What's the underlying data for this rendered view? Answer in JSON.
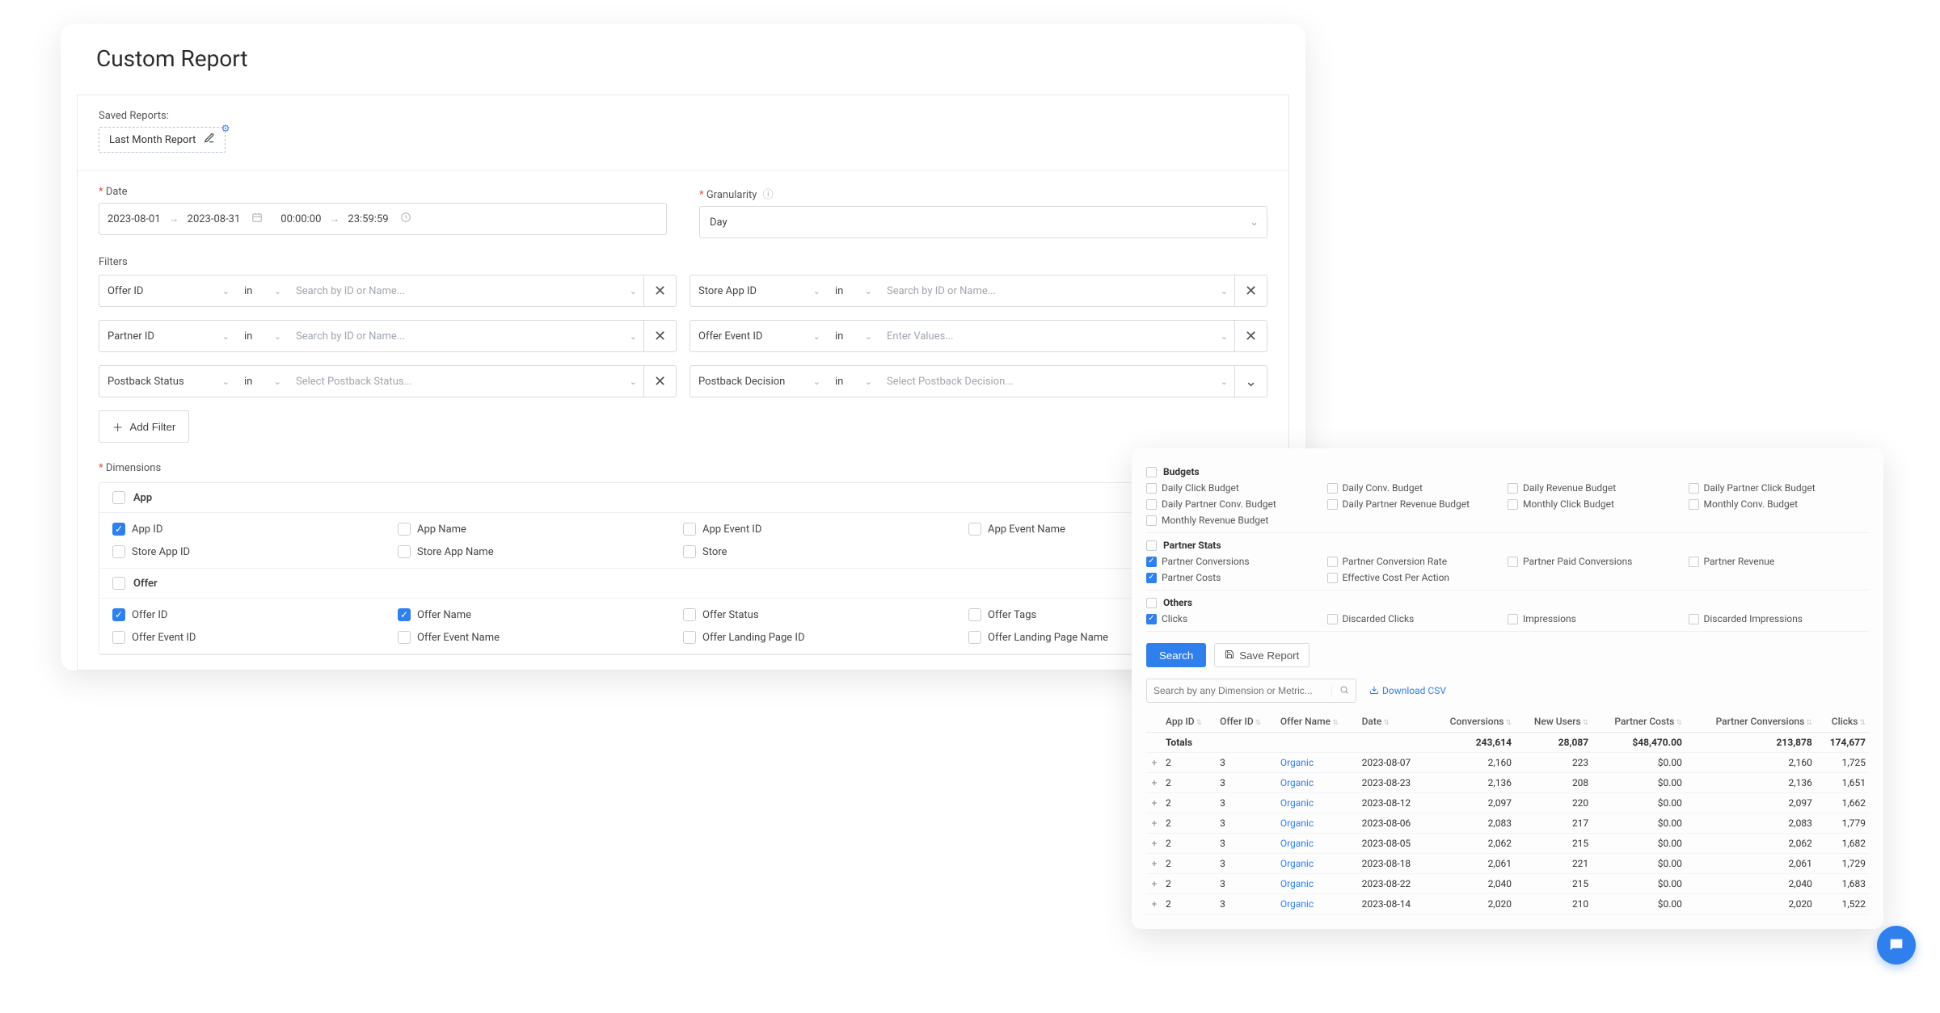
{
  "page": {
    "title": "Custom Report"
  },
  "saved": {
    "label": "Saved Reports:",
    "chip": "Last Month Report"
  },
  "date": {
    "label": "Date",
    "from": "2023-08-01",
    "to": "2023-08-31",
    "time_from": "00:00:00",
    "time_to": "23:59:59"
  },
  "granularity": {
    "label": "Granularity",
    "value": "Day"
  },
  "filters": {
    "title": "Filters",
    "rows": [
      {
        "left": {
          "field": "Offer ID",
          "op": "in",
          "placeholder": "Search by ID or Name..."
        },
        "right": {
          "field": "Store App ID",
          "op": "in",
          "placeholder": "Search by ID or Name..."
        }
      },
      {
        "left": {
          "field": "Partner ID",
          "op": "in",
          "placeholder": "Search by ID or Name..."
        },
        "right": {
          "field": "Offer Event ID",
          "op": "in",
          "placeholder": "Enter Values..."
        }
      },
      {
        "left": {
          "field": "Postback Status",
          "op": "in",
          "placeholder": "Select Postback Status..."
        },
        "right": {
          "field": "Postback Decision",
          "op": "in",
          "placeholder": "Select Postback Decision..."
        }
      }
    ],
    "add_button": "Add Filter"
  },
  "dimensions": {
    "label": "Dimensions",
    "groups": [
      {
        "title": "App",
        "checked": false,
        "items": [
          {
            "label": "App ID",
            "checked": true
          },
          {
            "label": "App Name",
            "checked": false
          },
          {
            "label": "App Event ID",
            "checked": false
          },
          {
            "label": "App Event Name",
            "checked": false
          },
          {
            "label": "Store App ID",
            "checked": false
          },
          {
            "label": "Store App Name",
            "checked": false
          },
          {
            "label": "Store",
            "checked": false
          }
        ]
      },
      {
        "title": "Offer",
        "checked": false,
        "items": [
          {
            "label": "Offer ID",
            "checked": true
          },
          {
            "label": "Offer Name",
            "checked": true
          },
          {
            "label": "Offer Status",
            "checked": false
          },
          {
            "label": "Offer Tags",
            "checked": false
          },
          {
            "label": "Offer Event ID",
            "checked": false
          },
          {
            "label": "Offer Event Name",
            "checked": false
          },
          {
            "label": "Offer Landing Page ID",
            "checked": false
          },
          {
            "label": "Offer Landing Page Name",
            "checked": false
          }
        ]
      }
    ]
  },
  "metrics": {
    "groups": [
      {
        "title": "Budgets",
        "checked": false,
        "items": [
          {
            "label": "Daily Click Budget",
            "checked": false
          },
          {
            "label": "Daily Conv. Budget",
            "checked": false
          },
          {
            "label": "Daily Revenue Budget",
            "checked": false
          },
          {
            "label": "Daily Partner Click Budget",
            "checked": false
          },
          {
            "label": "Daily Partner Conv. Budget",
            "checked": false
          },
          {
            "label": "Daily Partner Revenue Budget",
            "checked": false
          },
          {
            "label": "Monthly Click Budget",
            "checked": false
          },
          {
            "label": "Monthly Conv. Budget",
            "checked": false
          },
          {
            "label": "Monthly Revenue Budget",
            "checked": false
          }
        ]
      },
      {
        "title": "Partner Stats",
        "checked": false,
        "items": [
          {
            "label": "Partner Conversions",
            "checked": true
          },
          {
            "label": "Partner Conversion Rate",
            "checked": false
          },
          {
            "label": "Partner Paid Conversions",
            "checked": false
          },
          {
            "label": "Partner Revenue",
            "checked": false
          },
          {
            "label": "Partner Costs",
            "checked": true
          },
          {
            "label": "Effective Cost Per Action",
            "checked": false
          }
        ]
      },
      {
        "title": "Others",
        "checked": false,
        "items": [
          {
            "label": "Clicks",
            "checked": true
          },
          {
            "label": "Discarded Clicks",
            "checked": false
          },
          {
            "label": "Impressions",
            "checked": false
          },
          {
            "label": "Discarded Impressions",
            "checked": false
          }
        ]
      }
    ]
  },
  "actions": {
    "search": "Search",
    "save_report": "Save Report",
    "search_placeholder": "Search by any Dimension or Metric...",
    "download_csv": "Download CSV"
  },
  "table": {
    "columns": [
      "App ID",
      "Offer ID",
      "Offer Name",
      "Date",
      "Conversions",
      "New Users",
      "Partner Costs",
      "Partner Conversions",
      "Clicks"
    ],
    "totals_label": "Totals",
    "totals": {
      "conversions": "243,614",
      "new_users": "28,087",
      "partner_costs": "$48,470.00",
      "partner_conversions": "213,878",
      "clicks": "174,677"
    },
    "rows": [
      {
        "app_id": "2",
        "offer_id": "3",
        "offer_name": "Organic",
        "date": "2023-08-07",
        "conversions": "2,160",
        "new_users": "223",
        "partner_costs": "$0.00",
        "partner_conversions": "2,160",
        "clicks": "1,725"
      },
      {
        "app_id": "2",
        "offer_id": "3",
        "offer_name": "Organic",
        "date": "2023-08-23",
        "conversions": "2,136",
        "new_users": "208",
        "partner_costs": "$0.00",
        "partner_conversions": "2,136",
        "clicks": "1,651"
      },
      {
        "app_id": "2",
        "offer_id": "3",
        "offer_name": "Organic",
        "date": "2023-08-12",
        "conversions": "2,097",
        "new_users": "220",
        "partner_costs": "$0.00",
        "partner_conversions": "2,097",
        "clicks": "1,662"
      },
      {
        "app_id": "2",
        "offer_id": "3",
        "offer_name": "Organic",
        "date": "2023-08-06",
        "conversions": "2,083",
        "new_users": "217",
        "partner_costs": "$0.00",
        "partner_conversions": "2,083",
        "clicks": "1,779"
      },
      {
        "app_id": "2",
        "offer_id": "3",
        "offer_name": "Organic",
        "date": "2023-08-05",
        "conversions": "2,062",
        "new_users": "215",
        "partner_costs": "$0.00",
        "partner_conversions": "2,062",
        "clicks": "1,682"
      },
      {
        "app_id": "2",
        "offer_id": "3",
        "offer_name": "Organic",
        "date": "2023-08-18",
        "conversions": "2,061",
        "new_users": "221",
        "partner_costs": "$0.00",
        "partner_conversions": "2,061",
        "clicks": "1,729"
      },
      {
        "app_id": "2",
        "offer_id": "3",
        "offer_name": "Organic",
        "date": "2023-08-22",
        "conversions": "2,040",
        "new_users": "215",
        "partner_costs": "$0.00",
        "partner_conversions": "2,040",
        "clicks": "1,683"
      },
      {
        "app_id": "2",
        "offer_id": "3",
        "offer_name": "Organic",
        "date": "2023-08-14",
        "conversions": "2,020",
        "new_users": "210",
        "partner_costs": "$0.00",
        "partner_conversions": "2,020",
        "clicks": "1,522"
      }
    ]
  }
}
